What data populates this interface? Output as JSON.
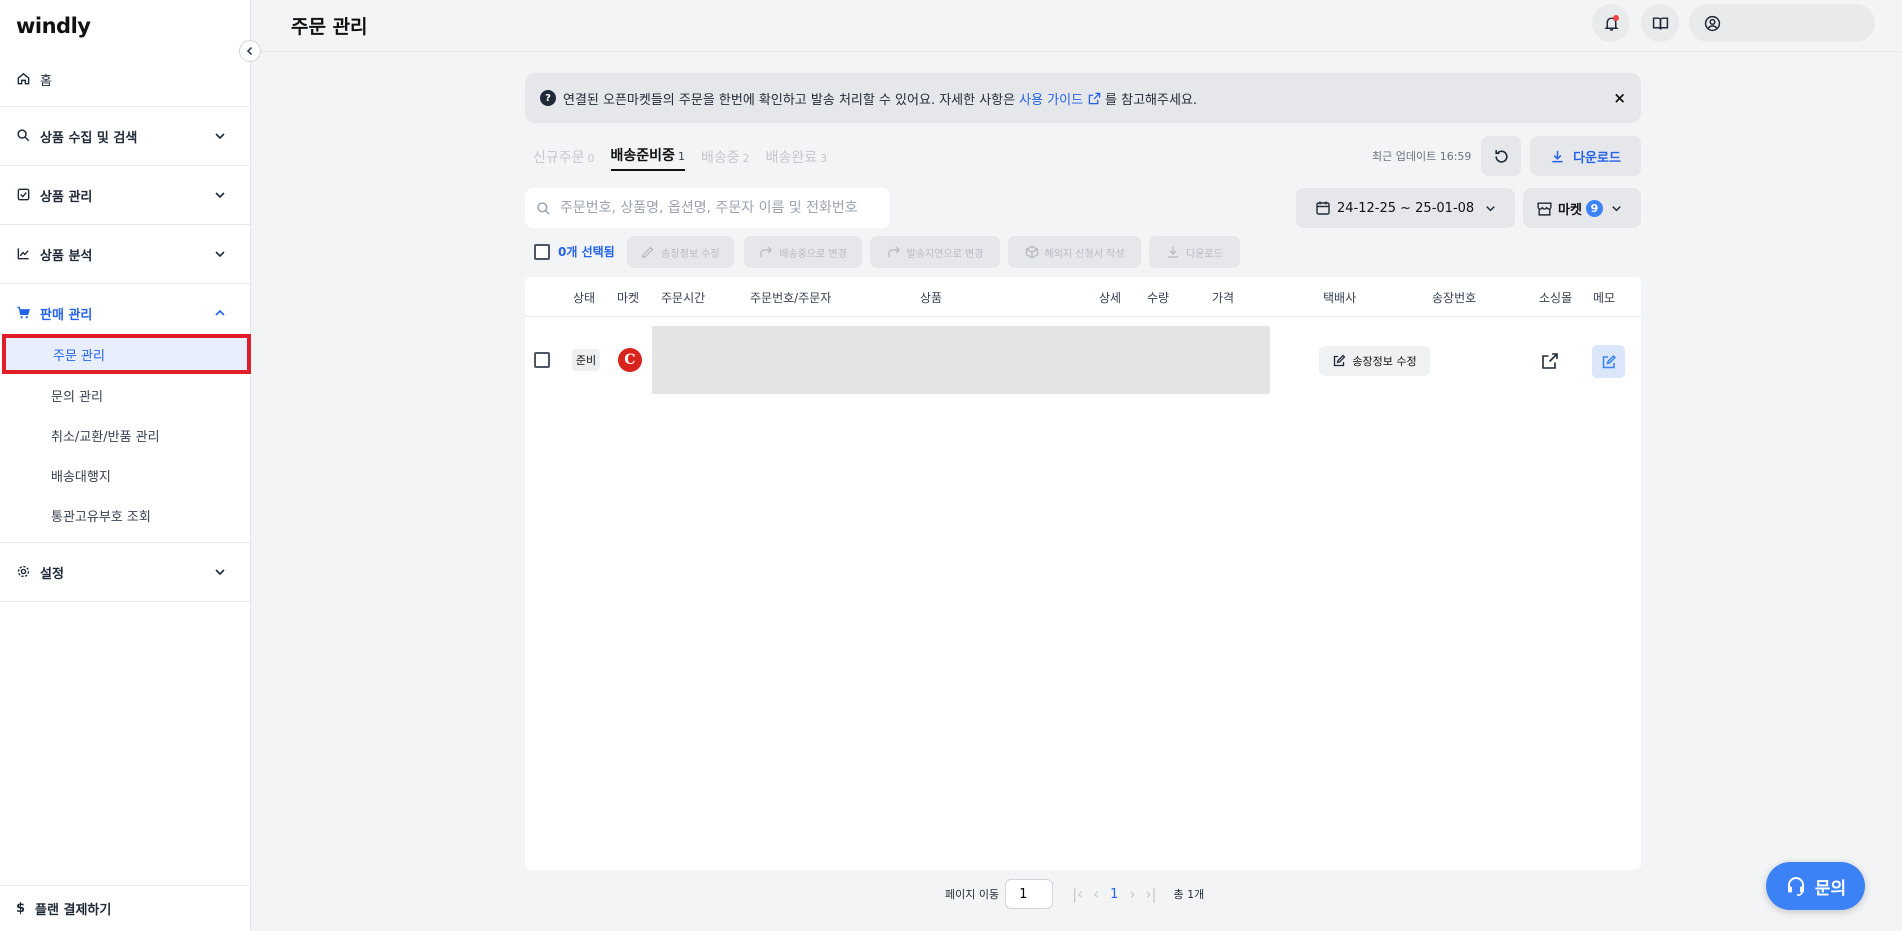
{
  "app": {
    "logo": "windly"
  },
  "sidebar": {
    "home": "홈",
    "groups": [
      {
        "label": "상품 수집 및 검색"
      },
      {
        "label": "상품 관리"
      },
      {
        "label": "상품 분석"
      },
      {
        "label": "판매 관리"
      },
      {
        "label": "설정"
      }
    ],
    "sales_items": [
      "주문 관리",
      "문의 관리",
      "취소/교환/반품 관리",
      "배송대행지",
      "통관고유부호 조회"
    ],
    "plan": "플랜 결제하기"
  },
  "header": {
    "title": "주문 관리"
  },
  "notice": {
    "text_before": "연결된 오픈마켓들의 주문을 한번에 확인하고 발송 처리할 수 있어요. 자세한 사항은",
    "link": "사용 가이드",
    "text_after": "를 참고해주세요.",
    "close": "×"
  },
  "tabs": [
    {
      "label": "신규주문",
      "count": "0"
    },
    {
      "label": "배송준비중",
      "count": "1"
    },
    {
      "label": "배송중",
      "count": "2"
    },
    {
      "label": "배송완료",
      "count": "3"
    }
  ],
  "toolbar": {
    "last_update": "최근 업데이트 16:59",
    "download": "다운로드",
    "search_placeholder": "주문번호, 상품명, 옵션명, 주문자 이름 및 전화번호",
    "date_range": "24-12-25 ~ 25-01-08",
    "market_label": "마켓",
    "market_count": "9",
    "selected": "0개 선택됨",
    "actions": [
      "송장정보 수정",
      "배송중으로 변경",
      "발송지연으로 변경",
      "해외지 신청서 작성",
      "다운로드"
    ]
  },
  "table": {
    "columns": [
      "상태",
      "마켓",
      "주문시간",
      "주문번호/주문자",
      "상품",
      "상세",
      "수량",
      "가격",
      "택배사",
      "송장번호",
      "소싱몰",
      "메모"
    ],
    "rows": [
      {
        "status": "준비",
        "market_logo": "C",
        "shipping_action": "송장정보 수정"
      }
    ]
  },
  "pagination": {
    "label": "페이지 이동",
    "input": "1",
    "current": "1",
    "total": "총 1개"
  },
  "fab": {
    "label": "문의"
  },
  "colors": {
    "accent": "#2563eb",
    "highlight": "#e11d2a",
    "fab": "#3b82f6"
  }
}
